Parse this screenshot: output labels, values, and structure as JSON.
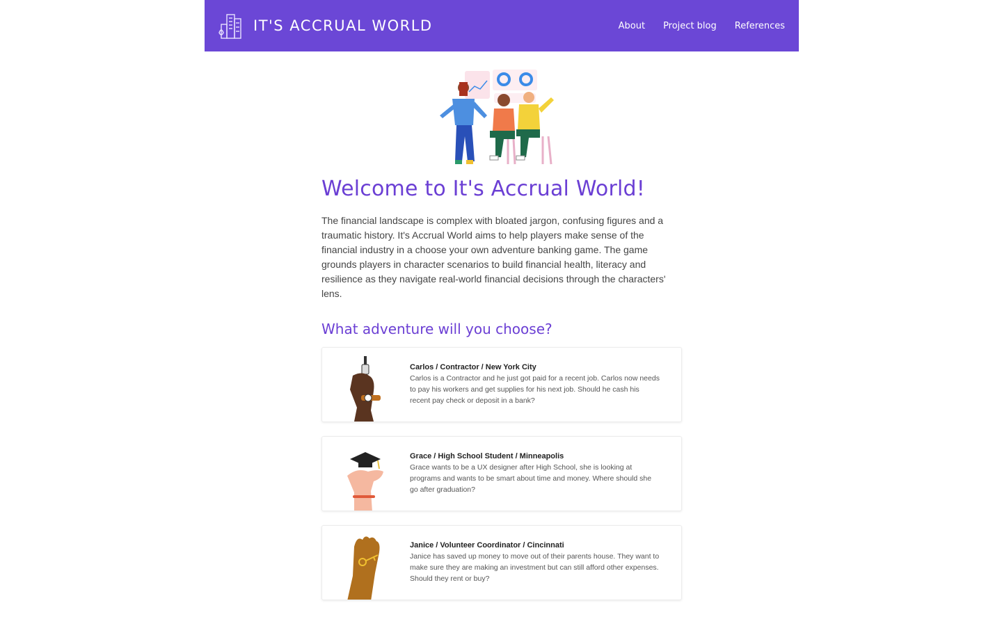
{
  "header": {
    "brand": "IT'S ACCRUAL WORLD",
    "nav": [
      "About",
      "Project blog",
      "References"
    ],
    "logo_icon": "city-buildings-icon"
  },
  "colors": {
    "brand_purple": "#6b47d6",
    "heading_purple": "#6b3fd4"
  },
  "main": {
    "title": "Welcome to It's Accrual World!",
    "intro": "The financial landscape is complex with bloated jargon, confusing figures and a traumatic history. It's Accrual World aims to help players make sense of the financial industry in a choose your own adventure banking game. The game grounds players in character scenarios to build financial health, literacy and resilience as they navigate real-world financial decisions through the characters' lens.",
    "subtitle": "What adventure will you choose?",
    "cards": [
      {
        "title": "Carlos / Contractor / New York City",
        "desc": "Carlos is a Contractor and he just got paid for a recent job. Carlos now needs to pay his workers and get supplies for his next job. Should he cash his recent pay check or deposit in a bank?",
        "icon": "hand-holding-tool-icon"
      },
      {
        "title": "Grace / High School Student / Minneapolis",
        "desc": "Grace wants to be a UX designer after High School, she is looking at programs and wants to be smart about time and money. Where should she go after graduation?",
        "icon": "hand-holding-graduation-cap-icon"
      },
      {
        "title": "Janice / Volunteer Coordinator / Cincinnati",
        "desc": "Janice has saved up money to move out of their parents house. They want to make sure they are making an investment but can still afford other expenses. Should they rent or buy?",
        "icon": "hand-holding-key-icon"
      }
    ]
  }
}
